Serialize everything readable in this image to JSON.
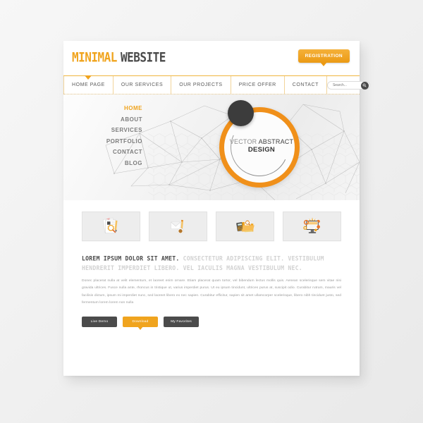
{
  "brand": {
    "name_part1": "MINIMAL",
    "name_part2": "WEBSITE",
    "accent_color": "#f0a41e",
    "dark_color": "#4a4a4a"
  },
  "header": {
    "registration_label": "REGISTRATION"
  },
  "nav": {
    "items": [
      {
        "label": "HOME PAGE",
        "active": true
      },
      {
        "label": "OUR SERVICES",
        "active": false
      },
      {
        "label": "OUR PROJECTS",
        "active": false
      },
      {
        "label": "PRICE OFFER",
        "active": false
      },
      {
        "label": "CONTACT",
        "active": false
      }
    ],
    "search": {
      "value": "",
      "placeholder": "Search...",
      "button_icon": "search-icon"
    }
  },
  "hero": {
    "side_menu": [
      {
        "label": "HOME",
        "active": true
      },
      {
        "label": "ABOUT",
        "active": false
      },
      {
        "label": "SERVICES",
        "active": false
      },
      {
        "label": "PORTFOLIO",
        "active": false
      },
      {
        "label": "CONTACT",
        "active": false
      },
      {
        "label": "BLOG",
        "active": false
      }
    ],
    "badge": {
      "line1_light": "VECTOR ",
      "line1_dark": "ABSTRACT",
      "line2": "DESIGN"
    }
  },
  "thumbnails": [
    {
      "icon": "documents-magnifier-pencil-icon",
      "label": ""
    },
    {
      "icon": "envelope-pencil-coffee-icon",
      "label": ""
    },
    {
      "icon": "calculator-folder-icon",
      "label": ""
    },
    {
      "icon": "monitor-gears-web-icon",
      "label": ""
    }
  ],
  "content": {
    "lead_strong": "LOREM IPSUM DOLOR SIT AMET.",
    "lead_soft": " CONSECTETUR ADIPISCING ELIT. VESTIBULUM HENDRERIT IMPERDIET LIBERO. VEL IACULIS MAGNA VESTIBULUM NEC.",
    "paragraph": "Donec placerat nulla at velit elementum, et laoreet enim ornare. Etiam placerat quam tortor, vel bibendum lectus mollis quis. Aenean scelerisque sem vitae nisi gravida ultrices. Fusce nulla ante, rhoncus in tristique ut, varius imperdiet purus. Ut eu ipsum tincidunt, ultrices purus at, suscipit odio. Curabitur rutrum, mauris vel facilisis dictum, ipsum mi imperdiet nunc, sed laoreet libero ex nec sapien. Curabitur efficitur, sapien sit amet ullamcorper scelerisque, libero nibh tincidunt justo, sed fermentum lorem lorem non nulla"
  },
  "buttons": [
    {
      "label": "Live Demo",
      "style": "dark"
    },
    {
      "label": "Download",
      "style": "orange"
    },
    {
      "label": "My Favorites",
      "style": "dark"
    }
  ]
}
